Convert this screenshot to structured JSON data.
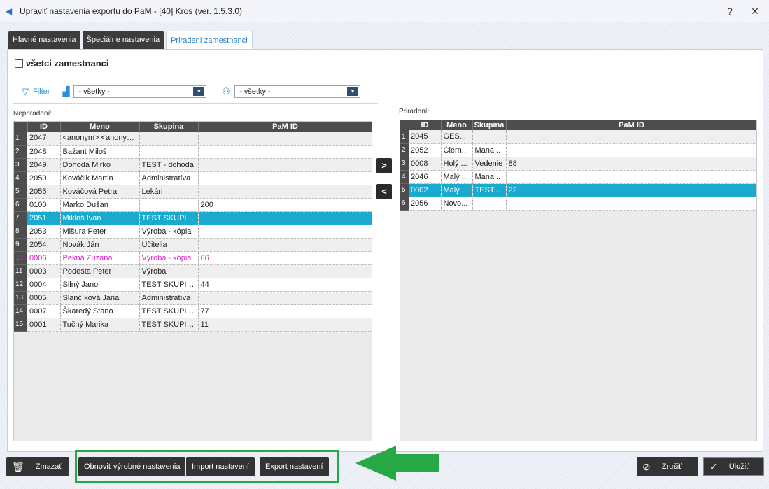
{
  "window": {
    "title": "Upraviť nastavenia exportu do PaM - [40] Kros (ver. 1.5.3.0)",
    "help_label": "?",
    "close_label": "✕"
  },
  "tabs": [
    {
      "label": "Hlavné nastavenia"
    },
    {
      "label": "Špeciálne nastavenia"
    },
    {
      "label": "Priradení zamestnanci"
    }
  ],
  "all_employees": {
    "label": "všetci zamestnanci",
    "checked": false
  },
  "filter": {
    "label": "Filter",
    "group_select": "- všetky -",
    "type_select": "- všetky -"
  },
  "left_grid": {
    "label": "Nepriradení:",
    "columns": [
      "ID",
      "Meno",
      "Skupina",
      "PaM ID"
    ],
    "rows": [
      {
        "n": "1",
        "id": "2047",
        "name": "<anonym> <anonym>",
        "group": "",
        "pam": "",
        "state": ""
      },
      {
        "n": "2",
        "id": "2048",
        "name": "Bažant Miloš",
        "group": "",
        "pam": "",
        "state": ""
      },
      {
        "n": "3",
        "id": "2049",
        "name": "Dohoda Mirko",
        "group": "TEST - dohoda",
        "pam": "",
        "state": ""
      },
      {
        "n": "4",
        "id": "2050",
        "name": "Kováčik Martin",
        "group": "Administratíva",
        "pam": "",
        "state": ""
      },
      {
        "n": "5",
        "id": "2055",
        "name": "Kováčová Petra",
        "group": "Lekári",
        "pam": "",
        "state": ""
      },
      {
        "n": "6",
        "id": "0100",
        "name": "Marko Dušan",
        "group": "",
        "pam": "200",
        "state": ""
      },
      {
        "n": "7",
        "id": "2051",
        "name": "Mikloš Ivan",
        "group": "TEST SKUPINA",
        "pam": "",
        "state": "selected"
      },
      {
        "n": "8",
        "id": "2053",
        "name": "Mišura Peter",
        "group": "Výroba - kópia",
        "pam": "",
        "state": ""
      },
      {
        "n": "9",
        "id": "2054",
        "name": "Novák Ján",
        "group": "Učitelia",
        "pam": "",
        "state": ""
      },
      {
        "n": "10",
        "id": "0006",
        "name": "Pekná Zuzana",
        "group": "Výroba - kópia",
        "pam": "66",
        "state": "pink"
      },
      {
        "n": "11",
        "id": "0003",
        "name": "Podesta Peter",
        "group": "Výroba",
        "pam": "",
        "state": ""
      },
      {
        "n": "12",
        "id": "0004",
        "name": "Silný Jano",
        "group": "TEST SKUPINA",
        "pam": "44",
        "state": ""
      },
      {
        "n": "13",
        "id": "0005",
        "name": "Slančíková Jana",
        "group": "Administratíva",
        "pam": "",
        "state": ""
      },
      {
        "n": "14",
        "id": "0007",
        "name": "Škaredý Stano",
        "group": "TEST SKUPINA",
        "pam": "77",
        "state": ""
      },
      {
        "n": "15",
        "id": "0001",
        "name": "Tučný Marika",
        "group": "TEST SKUPINA",
        "pam": "11",
        "state": ""
      }
    ]
  },
  "right_grid": {
    "label": "Priradení:",
    "columns": [
      "ID",
      "Meno",
      "Skupina",
      "PaM ID"
    ],
    "rows": [
      {
        "n": "1",
        "id": "2045",
        "name": "GES...",
        "group": "",
        "pam": "",
        "state": ""
      },
      {
        "n": "2",
        "id": "2052",
        "name": "Čiern...",
        "group": "Mana...",
        "pam": "",
        "state": ""
      },
      {
        "n": "3",
        "id": "0008",
        "name": "Holý ...",
        "group": "Vedenie",
        "pam": "88",
        "state": ""
      },
      {
        "n": "4",
        "id": "2046",
        "name": "Malý ...",
        "group": "Mana...",
        "pam": "",
        "state": ""
      },
      {
        "n": "5",
        "id": "0002",
        "name": "Malý ...",
        "group": "TEST...",
        "pam": "22",
        "state": "selected"
      },
      {
        "n": "6",
        "id": "2056",
        "name": "Novo...",
        "group": "",
        "pam": "",
        "state": ""
      }
    ]
  },
  "move_buttons": {
    "assign": ">",
    "unassign": "<"
  },
  "bottom": {
    "delete": "Zmazať",
    "restore": "Obnoviť výrobné nastavenia",
    "import": "Import nastavení",
    "export": "Export nastavení",
    "cancel": "Zrušiť",
    "save": "Uložiť"
  },
  "colors": {
    "accent": "#1aaad0",
    "highlight": "#27a844",
    "pink": "#e020c8",
    "dark": "#333333"
  }
}
